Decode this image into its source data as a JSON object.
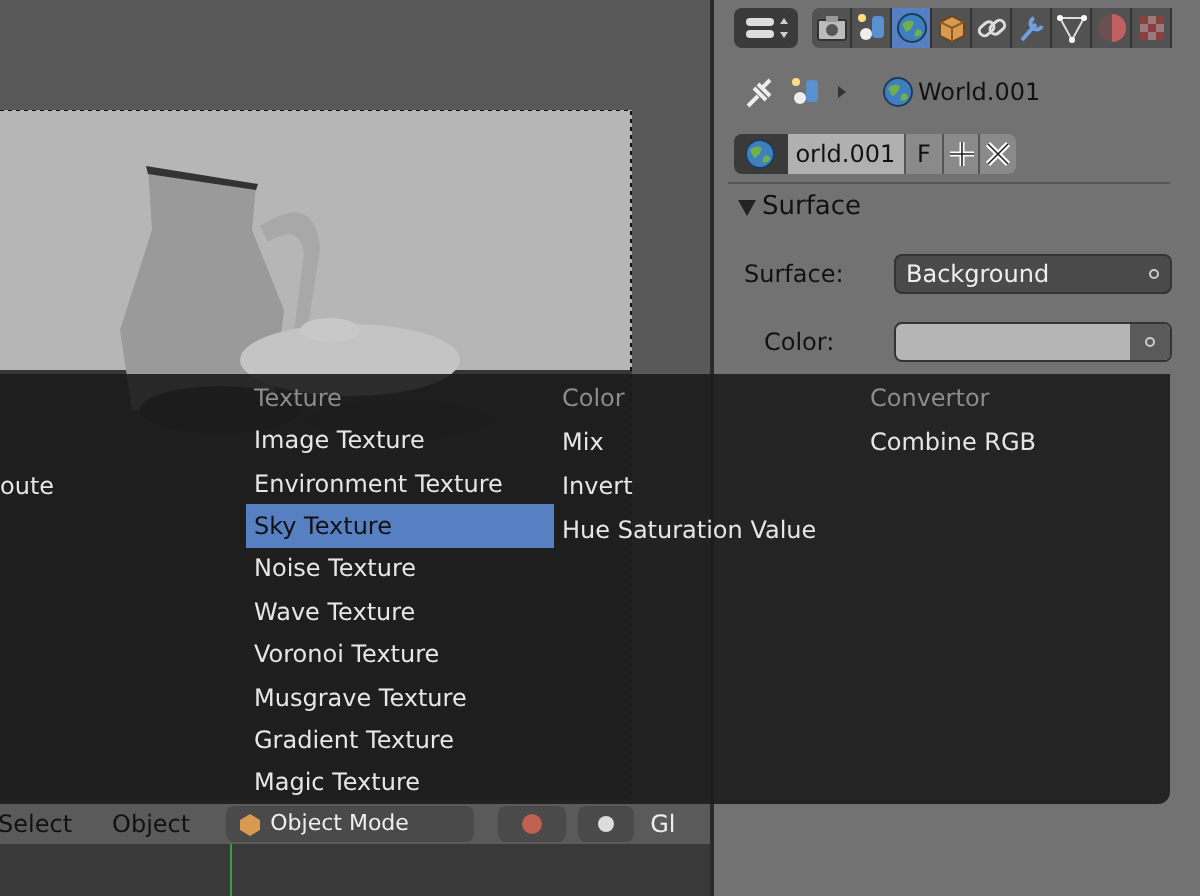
{
  "properties_tabs": [
    {
      "kind": "render",
      "selected": false
    },
    {
      "kind": "scene",
      "selected": false
    },
    {
      "kind": "world",
      "selected": true
    },
    {
      "kind": "object",
      "selected": false
    },
    {
      "kind": "constraints",
      "selected": false
    },
    {
      "kind": "modifiers",
      "selected": false
    },
    {
      "kind": "data",
      "selected": false
    },
    {
      "kind": "material",
      "selected": false
    },
    {
      "kind": "texture",
      "selected": false
    }
  ],
  "breadcrumb": {
    "world": "World.001"
  },
  "world_block": {
    "name": "orld.001",
    "fake_user": "F"
  },
  "surface_panel": {
    "title": "Surface",
    "expanded": true,
    "fields": [
      {
        "kind": "dropdown",
        "label": "Surface:",
        "value": "Background"
      },
      {
        "kind": "color",
        "label": "Color:"
      }
    ]
  },
  "add_menu": {
    "columns": [
      {
        "items": [
          {
            "label": "oute",
            "selected": false
          }
        ]
      },
      {
        "heading": "Texture",
        "items": [
          {
            "label": "Image Texture",
            "selected": false
          },
          {
            "label": "Environment Texture",
            "selected": false
          },
          {
            "label": "Sky Texture",
            "selected": true
          },
          {
            "label": "Noise Texture",
            "selected": false
          },
          {
            "label": "Wave Texture",
            "selected": false
          },
          {
            "label": "Voronoi Texture",
            "selected": false
          },
          {
            "label": "Musgrave Texture",
            "selected": false
          },
          {
            "label": "Gradient Texture",
            "selected": false
          },
          {
            "label": "Magic Texture",
            "selected": false
          }
        ]
      },
      {
        "heading": "Color",
        "items": [
          {
            "label": "Mix",
            "selected": false
          },
          {
            "label": "Invert",
            "selected": false
          },
          {
            "label": "Hue Saturation Value",
            "selected": false
          }
        ]
      },
      {
        "heading": "Convertor",
        "items": [
          {
            "label": "Combine RGB",
            "selected": false
          }
        ]
      }
    ]
  },
  "viewport_header": {
    "menus": [
      "Select",
      "Object"
    ],
    "mode": "Object Mode",
    "cut_label": "Gl"
  }
}
